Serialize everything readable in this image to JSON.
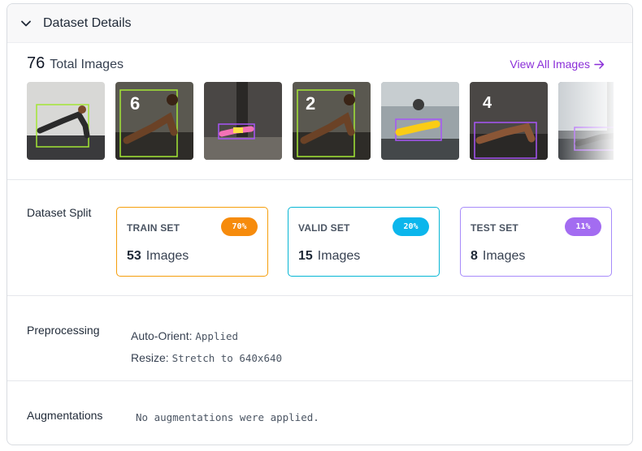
{
  "header": {
    "title": "Dataset Details"
  },
  "images": {
    "total_count": "76",
    "total_label": "Total Images",
    "view_all_label": "View All Images",
    "thumbnails": [
      {
        "label": "",
        "box_color": "#a3e635"
      },
      {
        "label": "6",
        "box_color": "#a3e635"
      },
      {
        "label": "",
        "box_color": "#a855f7"
      },
      {
        "label": "2",
        "box_color": "#a3e635"
      },
      {
        "label": "",
        "box_color": "#a855f7"
      },
      {
        "label": "4",
        "box_color": "#a855f7"
      },
      {
        "label": "",
        "box_color": "#a855f7"
      }
    ]
  },
  "split": {
    "label": "Dataset Split",
    "sets": [
      {
        "title": "TRAIN SET",
        "percent": "70%",
        "count": "53",
        "unit": "Images",
        "color": "#f59e0b",
        "badge": "#f68b0c"
      },
      {
        "title": "VALID SET",
        "percent": "20%",
        "count": "15",
        "unit": "Images",
        "color": "#06b6d4",
        "badge": "#0bb6ec"
      },
      {
        "title": "TEST SET",
        "percent": "11%",
        "count": "8",
        "unit": "Images",
        "color": "#a78bfa",
        "badge": "#a36cf1"
      }
    ]
  },
  "preprocessing": {
    "label": "Preprocessing",
    "steps": [
      {
        "name": "Auto-Orient:",
        "value": "Applied"
      },
      {
        "name": "Resize:",
        "value": "Stretch to 640x640"
      }
    ]
  },
  "augmentations": {
    "label": "Augmentations",
    "text": "No augmentations were applied."
  }
}
